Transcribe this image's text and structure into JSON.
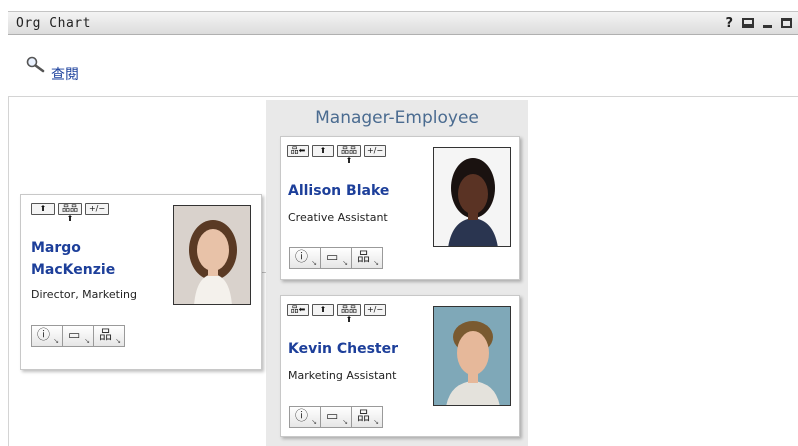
{
  "window": {
    "title": "Org Chart"
  },
  "toolbar": {
    "help_label": "?"
  },
  "lookup": {
    "label": "查閱"
  },
  "group": {
    "title": "Manager-Employee"
  },
  "controls": {
    "subordinate_back": "品⬅",
    "up": "⬆",
    "peers": "品品⬆",
    "toggle": "+/−"
  },
  "actions": {
    "info_glyph": "ⓘ",
    "mail_glyph": "▭",
    "tree_glyph": "品",
    "dropdown_glyph": "↘"
  },
  "manager": {
    "name": "Margo MacKenzie",
    "title": "Director, Marketing"
  },
  "employees": [
    {
      "name": "Allison Blake",
      "title": "Creative Assistant"
    },
    {
      "name": "Kevin Chester",
      "title": "Marketing Assistant"
    }
  ]
}
